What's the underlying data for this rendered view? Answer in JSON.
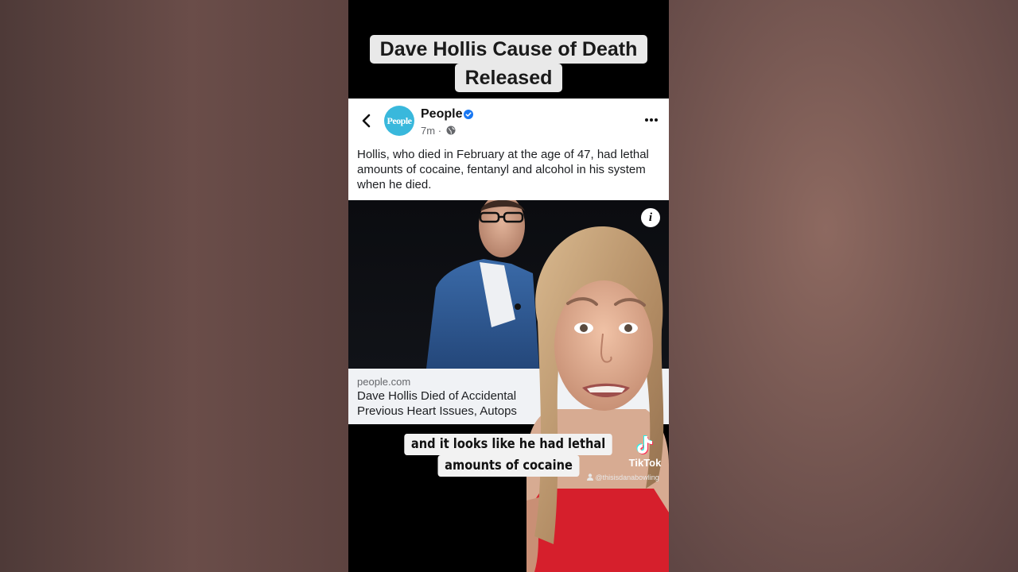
{
  "overlay": {
    "title_line1": "Dave Hollis Cause of Death",
    "title_line2": "Released",
    "caption_line1": "and it looks like he had lethal",
    "caption_line2": "amounts of cocaine"
  },
  "post": {
    "page_name": "People",
    "avatar_text": "People",
    "time": "7m",
    "meta_separator": "·",
    "text": "Hollis, who died in February at the age of 47, had lethal amounts of cocaine, fentanyl and alcohol in his system when he died."
  },
  "link": {
    "domain": "people.com",
    "title": "Dave Hollis Died of Accidental\nPrevious Heart Issues, Autops"
  },
  "watermark": {
    "brand": "TikTok",
    "handle": "@thisisdanabowling"
  },
  "colors": {
    "avatar_bg": "#39b8dc",
    "verified": "#1877f2",
    "dress": "#d61f2c"
  },
  "icons": {
    "back": "chevron-left-icon",
    "verified": "verified-badge-icon",
    "globe": "globe-icon",
    "more": "more-horizontal-icon",
    "info": "info-icon",
    "tiktok": "tiktok-note-icon",
    "user": "user-icon"
  }
}
